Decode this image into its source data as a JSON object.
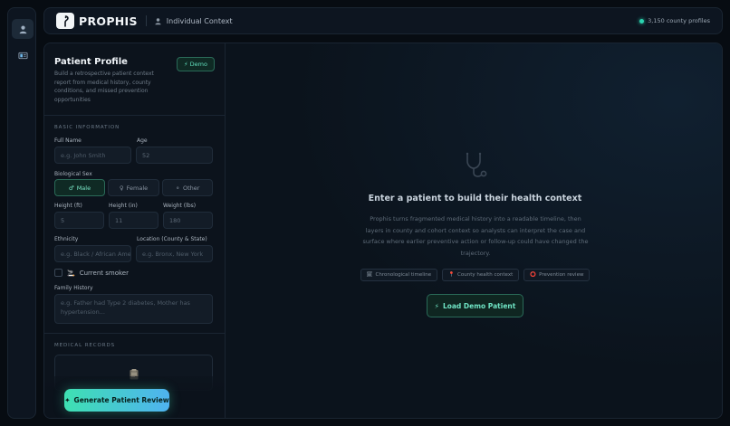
{
  "header": {
    "brand": "PROPHIS",
    "context_label": "Individual Context",
    "profiles_count": "3,150 county profiles",
    "accent_color": "#2bd4b0"
  },
  "sidebar_rail": {
    "items": [
      {
        "icon": "user-icon",
        "active": true
      },
      {
        "icon": "id-card-icon",
        "active": false
      }
    ]
  },
  "form": {
    "title": "Patient Profile",
    "description": "Build a retrospective patient context report from medical history, county conditions, and missed prevention opportunities",
    "demo_badge": "Demo",
    "basic_section": "BASIC INFORMATION",
    "full_name": {
      "label": "Full Name",
      "placeholder": "e.g. John Smith"
    },
    "age": {
      "label": "Age",
      "value": "52"
    },
    "sex": {
      "label": "Biological Sex",
      "options": [
        {
          "label": "Male",
          "glyph": "♂",
          "selected": true
        },
        {
          "label": "Female",
          "glyph": "♀",
          "selected": false
        },
        {
          "label": "Other",
          "glyph": "⚬",
          "selected": false
        }
      ]
    },
    "height_ft": {
      "label": "Height (ft)",
      "value": "5"
    },
    "height_in": {
      "label": "Height (in)",
      "value": "11"
    },
    "weight": {
      "label": "Weight (lbs)",
      "value": "180"
    },
    "ethnicity": {
      "label": "Ethnicity",
      "placeholder": "e.g. Black / African American"
    },
    "location": {
      "label": "Location (County & State)",
      "placeholder": "e.g. Bronx, New York"
    },
    "smoker": {
      "label": "Current smoker",
      "checked": false
    },
    "family_history": {
      "label": "Family History",
      "placeholder": "e.g. Father had Type 2 diabetes, Mother has hypertension..."
    },
    "records_section": "MEDICAL RECORDS",
    "generate_button": "Generate Patient Review"
  },
  "empty_state": {
    "icon": "stethoscope-icon",
    "headline": "Enter a patient to build their health context",
    "description": "Prophis turns fragmented medical history into a readable timeline, then layers in county and cohort context so analysts can interpret the case and surface where earlier preventive action or follow-up could have changed the trajectory.",
    "chips": [
      {
        "label": "Chronological timeline",
        "icon": "calendar-icon"
      },
      {
        "label": "County health context",
        "icon": "pin-icon"
      },
      {
        "label": "Prevention review",
        "icon": "target-icon"
      }
    ],
    "load_button": "Load Demo Patient"
  }
}
